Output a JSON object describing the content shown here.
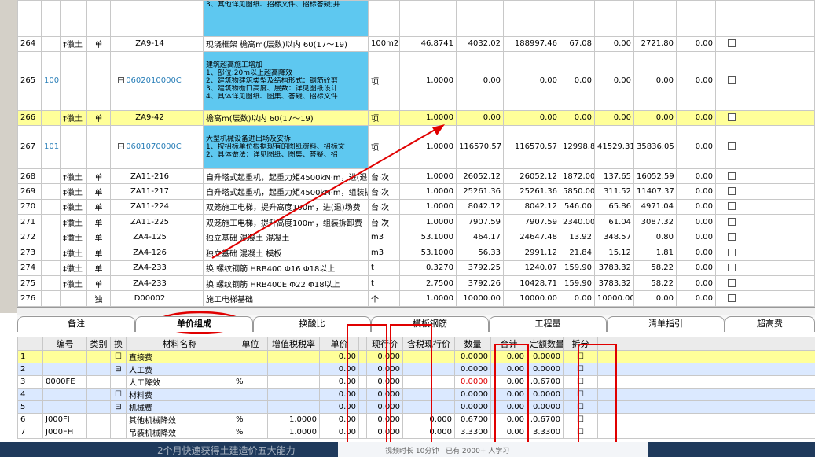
{
  "top_rows": [
    {
      "cells": [
        "",
        "",
        "",
        "",
        "",
        "3、其他详见图纸、招标文件、招标答疑;并",
        "",
        "",
        "",
        "",
        "",
        "",
        "",
        "",
        ""
      ],
      "kind": "partial"
    },
    {
      "cells": [
        "264",
        "",
        "‡徽土",
        "单",
        "ZA9-14",
        "现浇框架 檐高m(层数)以内 60(17～19)",
        "100m2",
        "46.8741",
        "4032.02",
        "188997.46",
        "67.08",
        "0.00",
        "2721.80",
        "0.00",
        ""
      ],
      "kind": "normal"
    },
    {
      "cells": [
        "265",
        "100",
        "",
        "",
        "0602010000C",
        "",
        "项",
        "1.0000",
        "0.00",
        "0.00",
        "0.00",
        "0.00",
        "0.00",
        "0.00",
        ""
      ],
      "kind": "blue",
      "lines": [
        "建筑超高施工增加",
        "1、部位:20m以上超高降效",
        "2、建筑物建筑类型及结构形式：钢筋砼剪",
        "3、建筑物檐口高度、层数：详见图纸设计",
        "4、具体详见图纸、图集、答疑、招标文件"
      ]
    },
    {
      "cells": [
        "266",
        "",
        "‡徽土",
        "单",
        "ZA9-42",
        "檐高m(层数)以内 60(17～19)",
        "项",
        "1.0000",
        "0.00",
        "0.00",
        "0.00",
        "0.00",
        "0.00",
        "0.00",
        ""
      ],
      "kind": "sel"
    },
    {
      "cells": [
        "267",
        "101",
        "",
        "",
        "0601070000C",
        "",
        "项",
        "1.0000",
        "116570.57",
        "116570.57",
        "12998.87",
        "41529.31",
        "35836.05",
        "0.00",
        ""
      ],
      "kind": "blue",
      "lines": [
        "大型机械设备进出场及安拆",
        "1、按招标单位根据现有的图纸资料、招标文",
        "2、具体做法：详见图纸、图集、答疑、招"
      ]
    },
    {
      "cells": [
        "268",
        "",
        "‡徽土",
        "单",
        "ZA11-216",
        "自升塔式起重机，起重力矩4500kN·m，进(退)",
        "台·次",
        "1.0000",
        "26052.12",
        "26052.12",
        "1872.00",
        "137.65",
        "16052.59",
        "0.00",
        ""
      ],
      "kind": "normal"
    },
    {
      "cells": [
        "269",
        "",
        "‡徽土",
        "单",
        "ZA11-217",
        "自升塔式起重机，起重力矩4500kN·m，组装拆",
        "台·次",
        "1.0000",
        "25261.36",
        "25261.36",
        "5850.00",
        "311.52",
        "11407.37",
        "0.00",
        ""
      ],
      "kind": "normal"
    },
    {
      "cells": [
        "270",
        "",
        "‡徽土",
        "单",
        "ZA11-224",
        "双笼施工电梯，提升高度100m，进(退)场费",
        "台·次",
        "1.0000",
        "8042.12",
        "8042.12",
        "546.00",
        "65.86",
        "4971.04",
        "0.00",
        ""
      ],
      "kind": "normal"
    },
    {
      "cells": [
        "271",
        "",
        "‡徽土",
        "单",
        "ZA11-225",
        "双笼施工电梯，提升高度100m，组装拆卸费",
        "台·次",
        "1.0000",
        "7907.59",
        "7907.59",
        "2340.00",
        "61.04",
        "3087.32",
        "0.00",
        ""
      ],
      "kind": "normal"
    },
    {
      "cells": [
        "272",
        "",
        "‡徽土",
        "单",
        "ZA4-125",
        "独立基础 混凝土 混凝土",
        "m3",
        "53.1000",
        "464.17",
        "24647.48",
        "13.92",
        "348.57",
        "0.80",
        "0.00",
        ""
      ],
      "kind": "normal"
    },
    {
      "cells": [
        "273",
        "",
        "‡徽土",
        "单",
        "ZA4-126",
        "独立基础 混凝土 模板",
        "m3",
        "53.1000",
        "56.33",
        "2991.12",
        "21.84",
        "15.12",
        "1.81",
        "0.00",
        ""
      ],
      "kind": "normal"
    },
    {
      "cells": [
        "274",
        "",
        "‡徽土",
        "单",
        "ZA4-233",
        "换 螺纹钢筋 HRB400 Φ16 Φ18以上",
        "t",
        "0.3270",
        "3792.25",
        "1240.07",
        "159.90",
        "3783.32",
        "58.22",
        "0.00",
        ""
      ],
      "kind": "normal"
    },
    {
      "cells": [
        "275",
        "",
        "‡徽土",
        "单",
        "ZA4-233",
        "换 螺纹钢筋 HRB400E Φ22 Φ18以上",
        "t",
        "2.7500",
        "3792.26",
        "10428.71",
        "159.90",
        "3783.32",
        "58.22",
        "0.00",
        ""
      ],
      "kind": "normal"
    },
    {
      "cells": [
        "276",
        "",
        "",
        "独",
        "D00002",
        "施工电梯基础",
        "个",
        "1.0000",
        "10000.00",
        "10000.00",
        "0.00",
        "10000.00",
        "0.00",
        "0.00",
        ""
      ],
      "kind": "normal"
    }
  ],
  "tabs": [
    "备注",
    "单价组成",
    "换酸比",
    "模板钢筋",
    "工程量",
    "清单指引",
    "超高费"
  ],
  "bottom_headers": [
    "",
    "编号",
    "类别",
    "换",
    "材料名称",
    "单位",
    "增值税税率",
    "单价",
    "",
    "现行价",
    "含税现行价",
    "数量",
    "合计",
    "定额数量",
    "拆分",
    ""
  ],
  "bottom_rows": [
    {
      "cells": [
        "1",
        "",
        "",
        "☐",
        "直接费",
        "",
        "",
        "0.00",
        "",
        "0.000",
        "",
        "0.0000",
        "0.00",
        "0.0000",
        "☐"
      ],
      "kind": "sel",
      "red": []
    },
    {
      "cells": [
        "2",
        "",
        "",
        "⊟",
        "人工费",
        "",
        "",
        "0.00",
        "",
        "0.000",
        "",
        "0.0000",
        "0.00",
        "0.0000",
        "☐"
      ],
      "kind": "blue",
      "red": []
    },
    {
      "cells": [
        "3",
        "0000FE",
        "",
        "",
        "人工降效",
        "%",
        "",
        "0.00",
        "",
        "0.000",
        "",
        "0.0000",
        "0.00",
        ".0.6700",
        "☐"
      ],
      "kind": "normal",
      "red": [
        11
      ]
    },
    {
      "cells": [
        "4",
        "",
        "",
        "☐",
        "材料费",
        "",
        "",
        "0.00",
        "",
        "0.000",
        "",
        "0.0000",
        "0.00",
        "0.0000",
        "☐"
      ],
      "kind": "blue",
      "red": []
    },
    {
      "cells": [
        "5",
        "",
        "",
        "⊟",
        "机械费",
        "",
        "",
        "0.00",
        "",
        "0.000",
        "",
        "0.0000",
        "0.00",
        "0.0000",
        "☐"
      ],
      "kind": "blue",
      "red": []
    },
    {
      "cells": [
        "6",
        "J000FI",
        "",
        "",
        "其他机械降效",
        "%",
        "1.0000",
        "0.00",
        "",
        "0.000",
        "0.000",
        "0.6700",
        "0.00",
        ".0.6700",
        "☐"
      ],
      "kind": "normal",
      "red": []
    },
    {
      "cells": [
        "7",
        "J000FH",
        "",
        "",
        "吊装机械降效",
        "%",
        "1.0000",
        "0.00",
        "",
        "0.000",
        "0.000",
        "3.3300",
        "0.00",
        "3.3300",
        "☐"
      ],
      "kind": "normal",
      "red": []
    }
  ],
  "banner": {
    "text": "2个月快速获得土建造价五大能力",
    "sub": "视频时长 10分钟 | 已有 2000+ 人学习"
  }
}
